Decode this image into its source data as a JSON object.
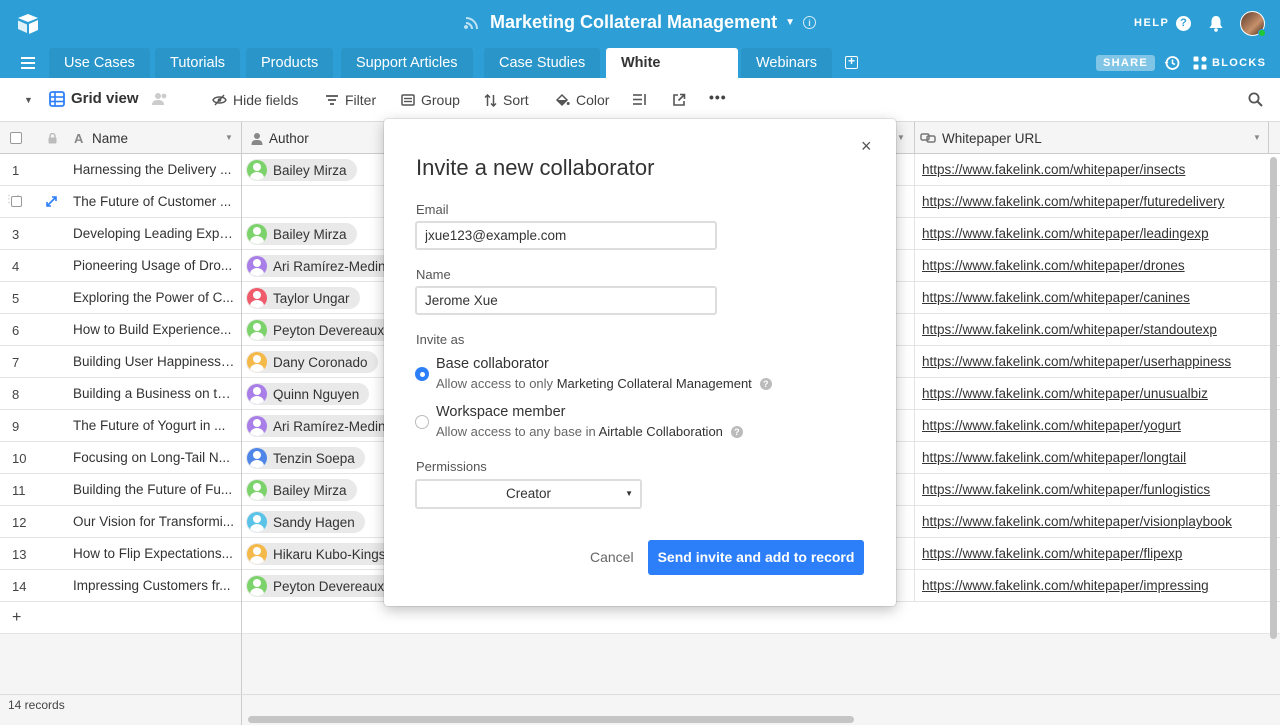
{
  "topbar": {
    "base_title": "Marketing Collateral Management",
    "help_label": "HELP"
  },
  "tabs": [
    {
      "label": "Use Cases",
      "active": false
    },
    {
      "label": "Tutorials",
      "active": false
    },
    {
      "label": "Products",
      "active": false
    },
    {
      "label": "Support Articles",
      "active": false
    },
    {
      "label": "Case Studies",
      "active": false
    },
    {
      "label": "White Papers",
      "active": true
    },
    {
      "label": "Webinars",
      "active": false
    }
  ],
  "share_label": "SHARE",
  "blocks_label": "BLOCKS",
  "toolbar": {
    "view_name": "Grid view",
    "hide_fields": "Hide fields",
    "filter": "Filter",
    "group": "Group",
    "sort": "Sort",
    "color": "Color"
  },
  "columns": {
    "name": "Name",
    "author": "Author",
    "url": "Whitepaper URL"
  },
  "rows": [
    {
      "num": "1",
      "name": "Harnessing the Delivery ...",
      "author": "Bailey Mirza",
      "author_color": "#7dd36b",
      "url": "https://www.fakelink.com/whitepaper/insects"
    },
    {
      "num": "",
      "name": "The Future of Customer ...",
      "author": "",
      "author_color": "",
      "url": "https://www.fakelink.com/whitepaper/futuredelivery"
    },
    {
      "num": "3",
      "name": "Developing Leading Expe...",
      "author": "Bailey Mirza",
      "author_color": "#7dd36b",
      "url": "https://www.fakelink.com/whitepaper/leadingexp"
    },
    {
      "num": "4",
      "name": "Pioneering Usage of Dro...",
      "author": "Ari Ramírez-Medina",
      "author_color": "#a97ee8",
      "url": "https://www.fakelink.com/whitepaper/drones"
    },
    {
      "num": "5",
      "name": "Exploring the Power of C...",
      "author": "Taylor Ungar",
      "author_color": "#ef5b6b",
      "url": "https://www.fakelink.com/whitepaper/canines"
    },
    {
      "num": "6",
      "name": "How to Build Experience...",
      "author": "Peyton Devereaux",
      "author_color": "#7dd36b",
      "url": "https://www.fakelink.com/whitepaper/standoutexp"
    },
    {
      "num": "7",
      "name": "Building User Happiness ...",
      "author": "Dany Coronado",
      "author_color": "#f5b94a",
      "url": "https://www.fakelink.com/whitepaper/userhappiness"
    },
    {
      "num": "8",
      "name": "Building a Business on th...",
      "author": "Quinn Nguyen",
      "author_color": "#a97ee8",
      "url": "https://www.fakelink.com/whitepaper/unusualbiz"
    },
    {
      "num": "9",
      "name": "The Future of Yogurt in ...",
      "author": "Ari Ramírez-Medina",
      "author_color": "#a97ee8",
      "url": "https://www.fakelink.com/whitepaper/yogurt"
    },
    {
      "num": "10",
      "name": "Focusing on Long-Tail N...",
      "author": "Tenzin Soepa",
      "author_color": "#4f86e8",
      "url": "https://www.fakelink.com/whitepaper/longtail"
    },
    {
      "num": "11",
      "name": "Building the Future of Fu...",
      "author": "Bailey Mirza",
      "author_color": "#7dd36b",
      "url": "https://www.fakelink.com/whitepaper/funlogistics"
    },
    {
      "num": "12",
      "name": "Our Vision for Transformi...",
      "author": "Sandy Hagen",
      "author_color": "#5bc2e8",
      "url": "https://www.fakelink.com/whitepaper/visionplaybook"
    },
    {
      "num": "13",
      "name": "How to Flip Expectations...",
      "author": "Hikaru Kubo-Kingsley",
      "author_color": "#f5b94a",
      "url": "https://www.fakelink.com/whitepaper/flipexp"
    },
    {
      "num": "14",
      "name": "Impressing Customers fr...",
      "author": "Peyton Devereaux",
      "author_color": "#7dd36b",
      "url": "https://www.fakelink.com/whitepaper/impressing"
    }
  ],
  "add_row": "+",
  "record_count": "14 records",
  "modal": {
    "title": "Invite a new collaborator",
    "email_label": "Email",
    "email_value": "jxue123@example.com",
    "name_label": "Name",
    "name_value": "Jerome Xue",
    "invite_as_label": "Invite as",
    "option1_title": "Base collaborator",
    "option1_desc": "Allow access to only",
    "option1_target": "Marketing Collateral Management",
    "option2_title": "Workspace member",
    "option2_desc": "Allow access to any base in",
    "option2_target": "Airtable Collaboration",
    "permissions_label": "Permissions",
    "permission_value": "Creator",
    "cancel_label": "Cancel",
    "send_label": "Send invite and add to record",
    "close": "×"
  },
  "colors": {
    "brand_blue": "#2d9fd6",
    "primary_button": "#2d7ff9"
  }
}
